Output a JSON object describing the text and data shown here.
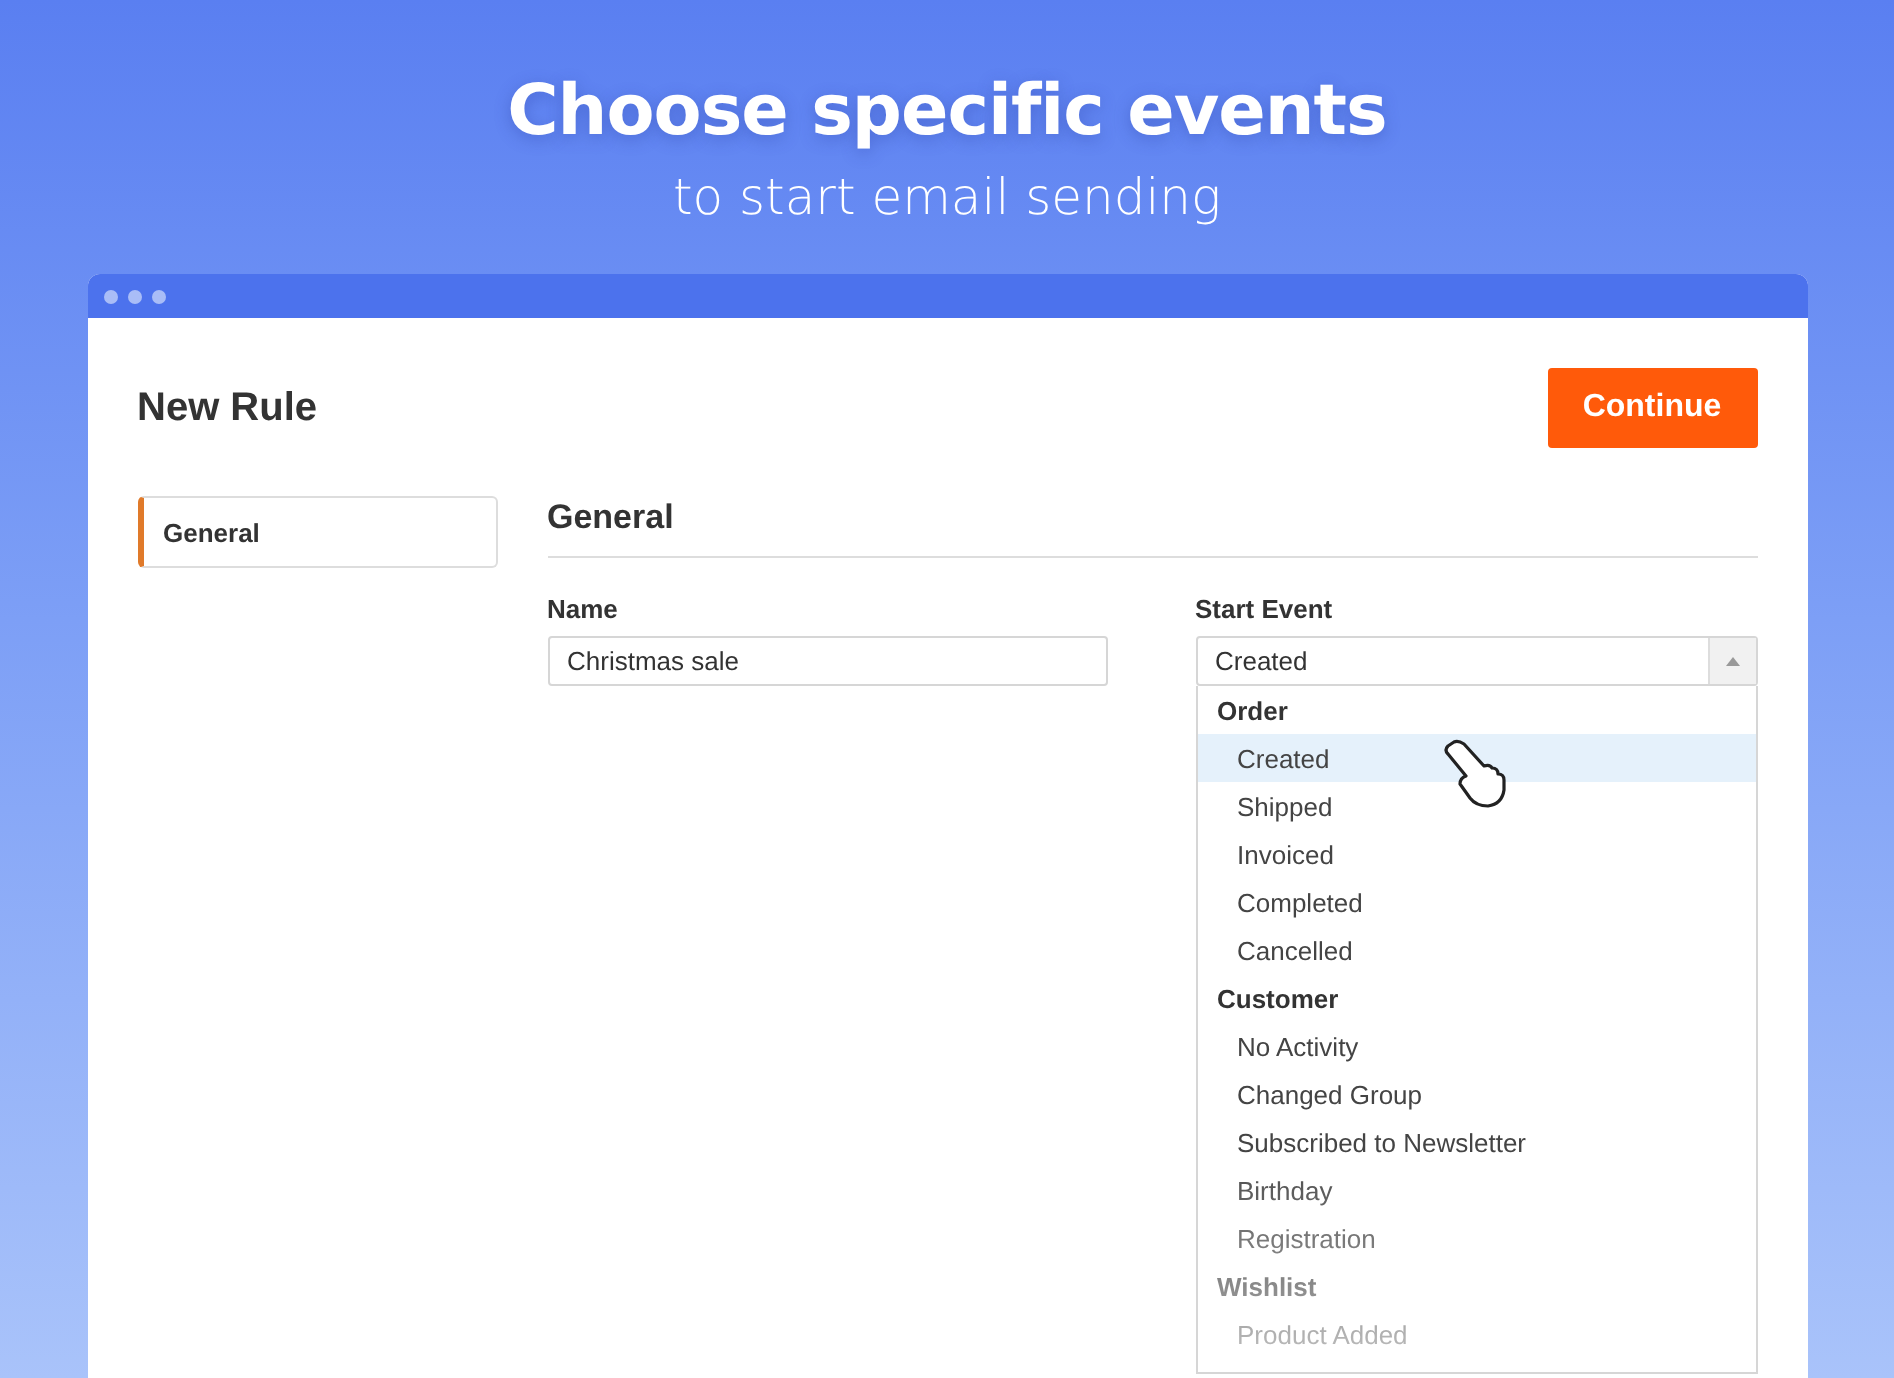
{
  "headline": {
    "title": "Choose specific events",
    "subtitle": "to start email sending"
  },
  "window": {
    "title": "New Rule",
    "primary_button": "Continue",
    "sidebar": {
      "items": [
        {
          "label": "General",
          "selected": true
        }
      ]
    },
    "section": {
      "title": "General",
      "fields": [
        {
          "kind": "text",
          "label": "Name",
          "value": "Christmas sale"
        },
        {
          "kind": "select",
          "label": "Start Event",
          "value": "Created",
          "expanded": true
        }
      ]
    },
    "dropdown": {
      "groups": [
        {
          "label": "Order",
          "options": [
            {
              "label": "Created",
              "selected": true
            },
            {
              "label": "Shipped",
              "selected": false
            },
            {
              "label": "Invoiced",
              "selected": false
            },
            {
              "label": "Completed",
              "selected": false
            },
            {
              "label": "Cancelled",
              "selected": false
            }
          ]
        },
        {
          "label": "Customer",
          "options": [
            {
              "label": "No Activity",
              "selected": false
            },
            {
              "label": "Changed Group",
              "selected": false
            },
            {
              "label": "Subscribed to Newsletter",
              "selected": false
            },
            {
              "label": "Birthday",
              "selected": false
            },
            {
              "label": "Registration",
              "selected": false
            }
          ]
        },
        {
          "label": "Wishlist",
          "options": [
            {
              "label": "Product Added",
              "selected": false
            }
          ]
        }
      ]
    }
  }
}
